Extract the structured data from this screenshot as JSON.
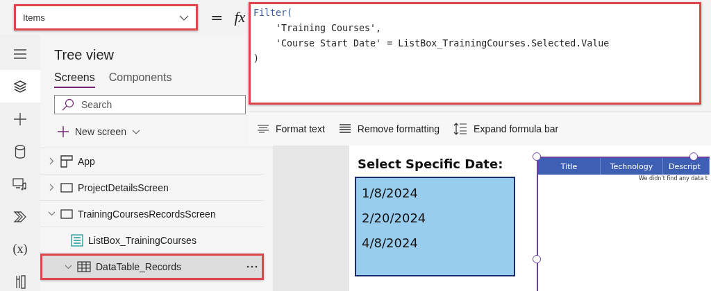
{
  "formula_bar": {
    "property": "Items",
    "equals": "=",
    "fx": "fx",
    "code_lines": [
      {
        "kind": "func",
        "text": "Filter("
      },
      {
        "kind": "arg",
        "text": "    'Training Courses',"
      },
      {
        "kind": "arg",
        "text": "    'Course Start Date' = ListBox_TrainingCourses.Selected.Value"
      },
      {
        "kind": "close",
        "text": ")"
      }
    ],
    "toolbar": [
      {
        "label": "Format text"
      },
      {
        "label": "Remove formatting"
      },
      {
        "label": "Expand formula bar"
      }
    ]
  },
  "rail": [
    {
      "selected": false
    },
    {
      "selected": true
    },
    {
      "selected": false
    },
    {
      "selected": false
    },
    {
      "selected": false
    },
    {
      "selected": false
    },
    {
      "label": "(x)",
      "selected": false
    },
    {
      "selected": false
    }
  ],
  "tree_view": {
    "title": "Tree view",
    "tabs": [
      {
        "label": "Screens",
        "selected": true
      },
      {
        "label": "Components",
        "selected": false
      }
    ],
    "search": {
      "placeholder": "Search"
    },
    "new_screen": "New screen",
    "items": [
      {
        "label": "App",
        "kind": "app",
        "expanded": false,
        "selected": false
      },
      {
        "label": "ProjectDetailsScreen",
        "kind": "screen",
        "expanded": false,
        "selected": false
      },
      {
        "label": "TrainingCoursesRecordsScreen",
        "kind": "screen",
        "expanded": true,
        "selected": false,
        "children": [
          {
            "label": "ListBox_TrainingCourses",
            "kind": "listbox",
            "selected": false
          },
          {
            "label": "DataTable_Records",
            "kind": "table",
            "expanded": true,
            "selected": true
          }
        ]
      }
    ]
  },
  "canvas": {
    "heading": "Select Specific Date:",
    "listbox": [
      "1/8/2024",
      "2/20/2024",
      "4/8/2024"
    ],
    "data_table": {
      "columns": [
        "Title",
        "Technology",
        "Descript"
      ],
      "empty_message": "We didn't find any data t"
    }
  }
}
